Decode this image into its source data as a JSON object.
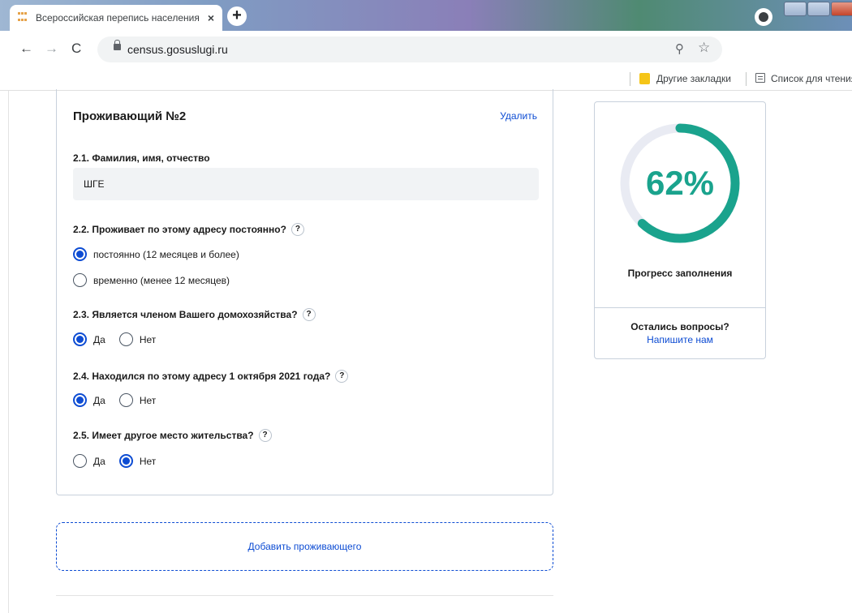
{
  "browser": {
    "tab_title": "Всероссийская перепись населения",
    "tab_close": "×",
    "new_tab": "+",
    "url": "census.gosuslugi.ru",
    "bookmarks": {
      "other": "Другие закладки",
      "reading_list": "Список для чтения"
    }
  },
  "form": {
    "title": "Проживающий №2",
    "delete_label": "Удалить",
    "name_question": "2.1. Фамилия, имя, отчество",
    "name_value": "ШГЕ",
    "q22": {
      "label": "2.2. Проживает по этому адресу постоянно?",
      "options": [
        "постоянно (12 месяцев и более)",
        "временно (менее 12 месяцев)"
      ],
      "selected": 0
    },
    "q23": {
      "label": "2.3. Является членом Вашего домохозяйства?",
      "options": [
        "Да",
        "Нет"
      ],
      "selected": 0
    },
    "q24": {
      "label": "2.4. Находился по этому адресу 1 октября 2021 года?",
      "options": [
        "Да",
        "Нет"
      ],
      "selected": 0
    },
    "q25": {
      "label": "2.5. Имеет другое место жительства?",
      "options": [
        "Да",
        "Нет"
      ],
      "selected": 1
    },
    "help_mark": "?",
    "add_resident": "Добавить проживающего"
  },
  "sidebar": {
    "progress_percent": 62,
    "progress_text": "62%",
    "progress_label": "Прогресс заполнения",
    "questions_title": "Остались вопросы?",
    "write_us": "Напишите нам"
  },
  "colors": {
    "accent_blue": "#0d4cd3",
    "progress_green": "#1aa38d",
    "ring_track": "#e9ebf3"
  },
  "icons": [
    "back-arrow-icon",
    "forward-arrow-icon",
    "reload-icon",
    "lock-icon",
    "zoom-icon",
    "star-icon",
    "folder-icon",
    "reading-list-icon",
    "question-icon"
  ]
}
